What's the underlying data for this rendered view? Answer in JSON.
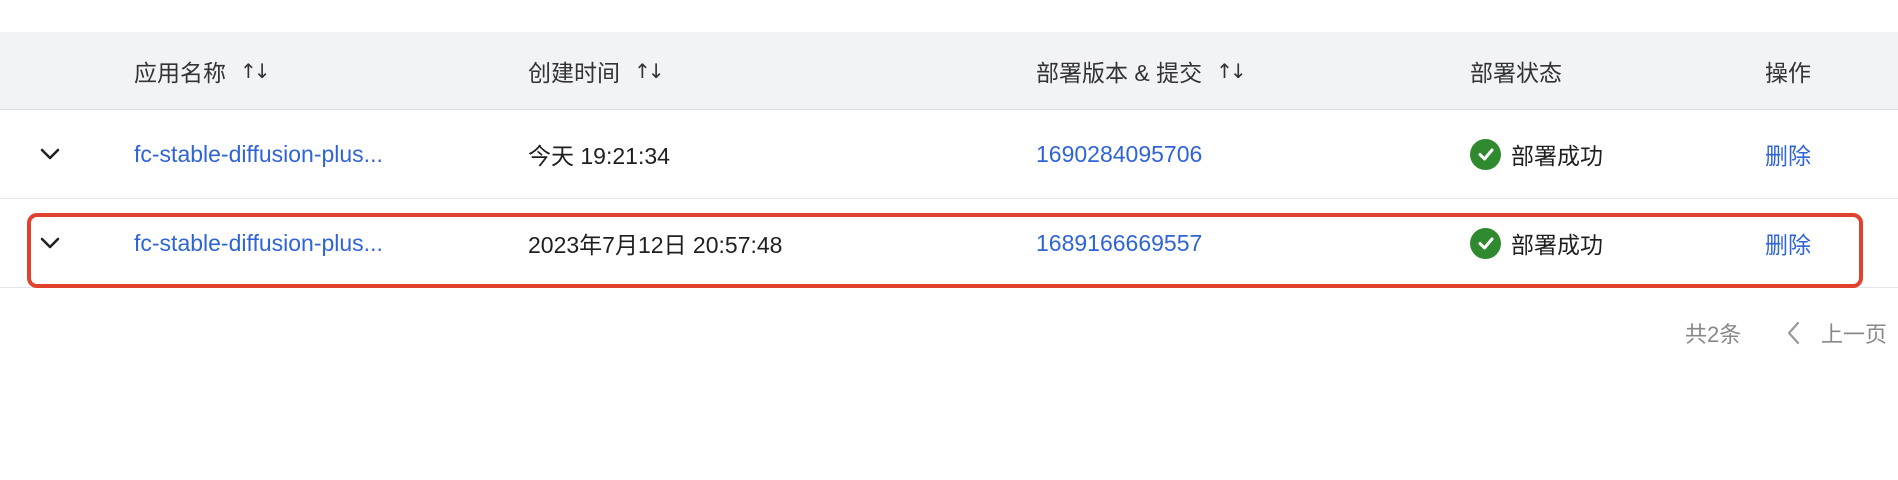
{
  "table": {
    "columns": {
      "name": "应用名称",
      "created": "创建时间",
      "version": "部署版本 & 提交",
      "status": "部署状态",
      "actions": "操作"
    },
    "sort_icon": "sort-icon",
    "rows": [
      {
        "name": "fc-stable-diffusion-plus...",
        "created": "今天 19:21:34",
        "version": "1690284095706",
        "status": "部署成功",
        "action": "删除"
      },
      {
        "name": "fc-stable-diffusion-plus...",
        "created": "2023年7月12日 20:57:48",
        "version": "1689166669557",
        "status": "部署成功",
        "action": "删除"
      }
    ]
  },
  "pagination": {
    "total": "共2条",
    "prev_label": "上一页"
  },
  "colors": {
    "link": "#2f64d7",
    "success": "#2f8a2f",
    "highlight": "#e0422e",
    "header_bg": "#f2f3f7"
  }
}
